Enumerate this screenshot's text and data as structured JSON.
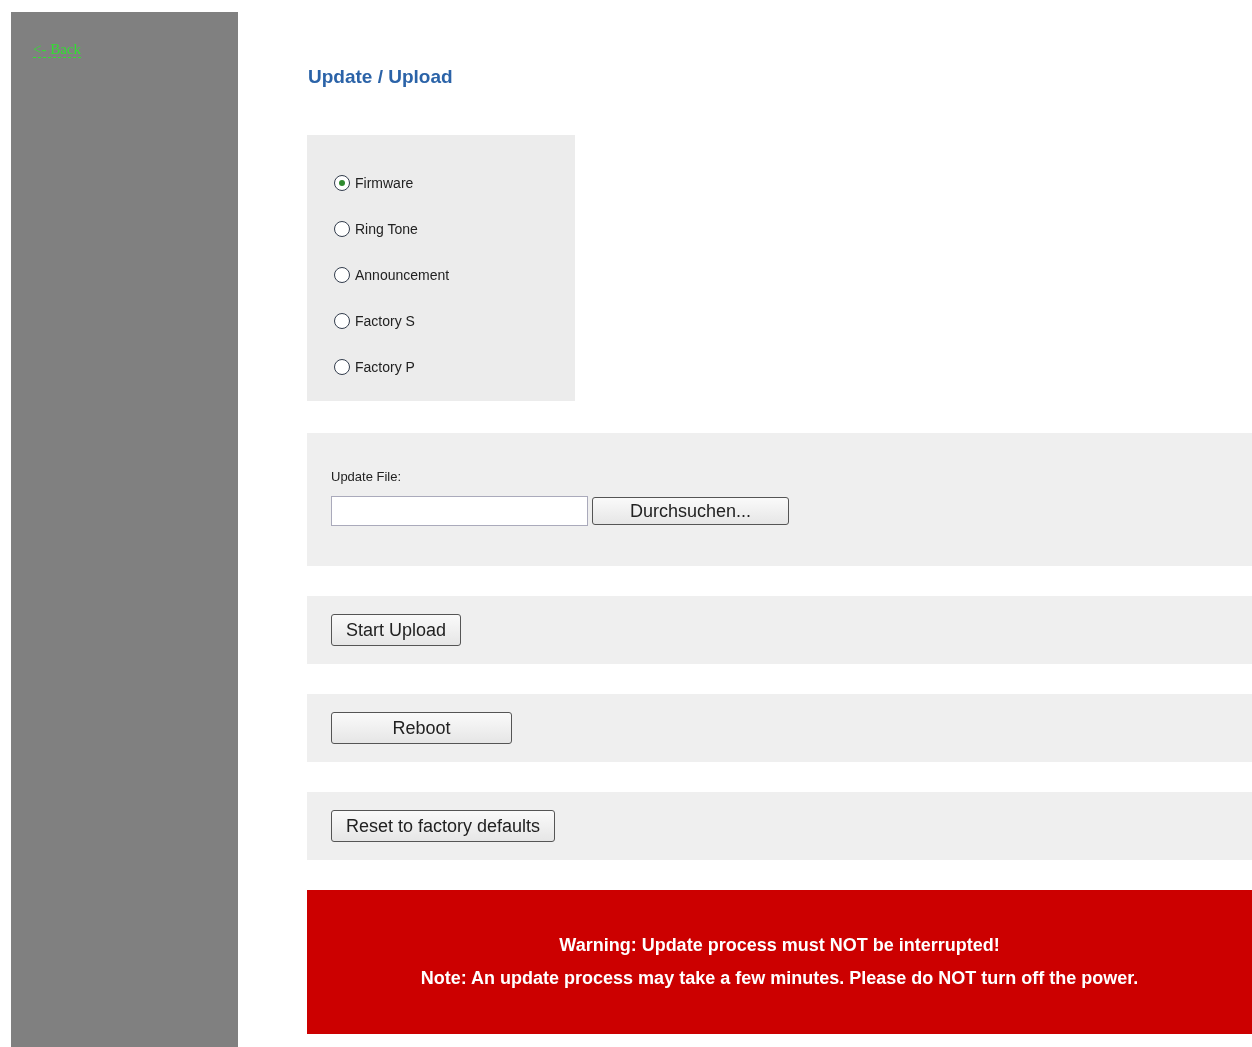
{
  "sidebar": {
    "back_link": "<- Back"
  },
  "title": "Update / Upload",
  "upload_types": [
    {
      "label": "Firmware",
      "selected": true
    },
    {
      "label": "Ring Tone",
      "selected": false
    },
    {
      "label": "Announcement",
      "selected": false
    },
    {
      "label": "Factory S",
      "selected": false
    },
    {
      "label": "Factory P",
      "selected": false
    }
  ],
  "file": {
    "label": "Update File:",
    "browse_button": "Durchsuchen..."
  },
  "actions": [
    "Start Upload",
    "Reboot",
    "Reset to factory defaults"
  ],
  "warning": [
    "Warning: Update process must NOT be interrupted!",
    "Note: An update process may take a few minutes. Please do NOT turn off the power."
  ]
}
